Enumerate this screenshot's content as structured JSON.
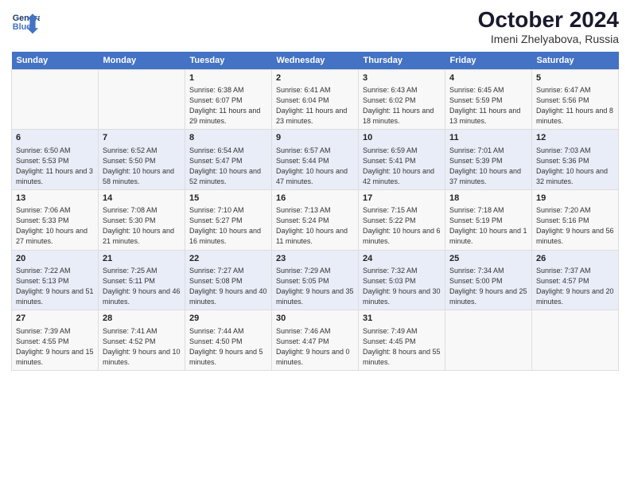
{
  "logo": {
    "line1": "General",
    "line2": "Blue"
  },
  "title": "October 2024",
  "subtitle": "Imeni Zhelyabova, Russia",
  "days": [
    "Sunday",
    "Monday",
    "Tuesday",
    "Wednesday",
    "Thursday",
    "Friday",
    "Saturday"
  ],
  "weeks": [
    [
      {
        "day": "",
        "content": ""
      },
      {
        "day": "",
        "content": ""
      },
      {
        "day": "1",
        "content": "Sunrise: 6:38 AM\nSunset: 6:07 PM\nDaylight: 11 hours and 29 minutes."
      },
      {
        "day": "2",
        "content": "Sunrise: 6:41 AM\nSunset: 6:04 PM\nDaylight: 11 hours and 23 minutes."
      },
      {
        "day": "3",
        "content": "Sunrise: 6:43 AM\nSunset: 6:02 PM\nDaylight: 11 hours and 18 minutes."
      },
      {
        "day": "4",
        "content": "Sunrise: 6:45 AM\nSunset: 5:59 PM\nDaylight: 11 hours and 13 minutes."
      },
      {
        "day": "5",
        "content": "Sunrise: 6:47 AM\nSunset: 5:56 PM\nDaylight: 11 hours and 8 minutes."
      }
    ],
    [
      {
        "day": "6",
        "content": "Sunrise: 6:50 AM\nSunset: 5:53 PM\nDaylight: 11 hours and 3 minutes."
      },
      {
        "day": "7",
        "content": "Sunrise: 6:52 AM\nSunset: 5:50 PM\nDaylight: 10 hours and 58 minutes."
      },
      {
        "day": "8",
        "content": "Sunrise: 6:54 AM\nSunset: 5:47 PM\nDaylight: 10 hours and 52 minutes."
      },
      {
        "day": "9",
        "content": "Sunrise: 6:57 AM\nSunset: 5:44 PM\nDaylight: 10 hours and 47 minutes."
      },
      {
        "day": "10",
        "content": "Sunrise: 6:59 AM\nSunset: 5:41 PM\nDaylight: 10 hours and 42 minutes."
      },
      {
        "day": "11",
        "content": "Sunrise: 7:01 AM\nSunset: 5:39 PM\nDaylight: 10 hours and 37 minutes."
      },
      {
        "day": "12",
        "content": "Sunrise: 7:03 AM\nSunset: 5:36 PM\nDaylight: 10 hours and 32 minutes."
      }
    ],
    [
      {
        "day": "13",
        "content": "Sunrise: 7:06 AM\nSunset: 5:33 PM\nDaylight: 10 hours and 27 minutes."
      },
      {
        "day": "14",
        "content": "Sunrise: 7:08 AM\nSunset: 5:30 PM\nDaylight: 10 hours and 21 minutes."
      },
      {
        "day": "15",
        "content": "Sunrise: 7:10 AM\nSunset: 5:27 PM\nDaylight: 10 hours and 16 minutes."
      },
      {
        "day": "16",
        "content": "Sunrise: 7:13 AM\nSunset: 5:24 PM\nDaylight: 10 hours and 11 minutes."
      },
      {
        "day": "17",
        "content": "Sunrise: 7:15 AM\nSunset: 5:22 PM\nDaylight: 10 hours and 6 minutes."
      },
      {
        "day": "18",
        "content": "Sunrise: 7:18 AM\nSunset: 5:19 PM\nDaylight: 10 hours and 1 minute."
      },
      {
        "day": "19",
        "content": "Sunrise: 7:20 AM\nSunset: 5:16 PM\nDaylight: 9 hours and 56 minutes."
      }
    ],
    [
      {
        "day": "20",
        "content": "Sunrise: 7:22 AM\nSunset: 5:13 PM\nDaylight: 9 hours and 51 minutes."
      },
      {
        "day": "21",
        "content": "Sunrise: 7:25 AM\nSunset: 5:11 PM\nDaylight: 9 hours and 46 minutes."
      },
      {
        "day": "22",
        "content": "Sunrise: 7:27 AM\nSunset: 5:08 PM\nDaylight: 9 hours and 40 minutes."
      },
      {
        "day": "23",
        "content": "Sunrise: 7:29 AM\nSunset: 5:05 PM\nDaylight: 9 hours and 35 minutes."
      },
      {
        "day": "24",
        "content": "Sunrise: 7:32 AM\nSunset: 5:03 PM\nDaylight: 9 hours and 30 minutes."
      },
      {
        "day": "25",
        "content": "Sunrise: 7:34 AM\nSunset: 5:00 PM\nDaylight: 9 hours and 25 minutes."
      },
      {
        "day": "26",
        "content": "Sunrise: 7:37 AM\nSunset: 4:57 PM\nDaylight: 9 hours and 20 minutes."
      }
    ],
    [
      {
        "day": "27",
        "content": "Sunrise: 7:39 AM\nSunset: 4:55 PM\nDaylight: 9 hours and 15 minutes."
      },
      {
        "day": "28",
        "content": "Sunrise: 7:41 AM\nSunset: 4:52 PM\nDaylight: 9 hours and 10 minutes."
      },
      {
        "day": "29",
        "content": "Sunrise: 7:44 AM\nSunset: 4:50 PM\nDaylight: 9 hours and 5 minutes."
      },
      {
        "day": "30",
        "content": "Sunrise: 7:46 AM\nSunset: 4:47 PM\nDaylight: 9 hours and 0 minutes."
      },
      {
        "day": "31",
        "content": "Sunrise: 7:49 AM\nSunset: 4:45 PM\nDaylight: 8 hours and 55 minutes."
      },
      {
        "day": "",
        "content": ""
      },
      {
        "day": "",
        "content": ""
      }
    ]
  ]
}
